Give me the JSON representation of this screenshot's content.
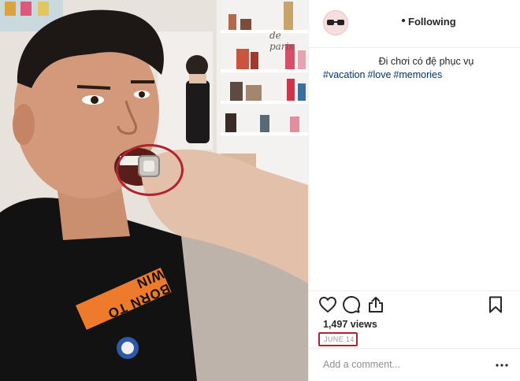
{
  "post_header": {
    "follow_label": "Following"
  },
  "caption": {
    "text": "Đi chơi có đệ phục vụ",
    "hashtags": [
      "#vacation",
      "#love",
      "#memories"
    ]
  },
  "stats": {
    "views": "1,497 views",
    "date": "JUNE 14"
  },
  "comment": {
    "placeholder": "Add a comment..."
  },
  "photo": {
    "shirt_text": "BORN TO WIN",
    "shop_sign": "de paris",
    "highlight_color": "#b3232f"
  },
  "icons": {
    "like": "heart-icon",
    "comment": "speech-bubble-icon",
    "share": "share-icon",
    "save": "bookmark-icon",
    "more": "more-options-icon"
  }
}
